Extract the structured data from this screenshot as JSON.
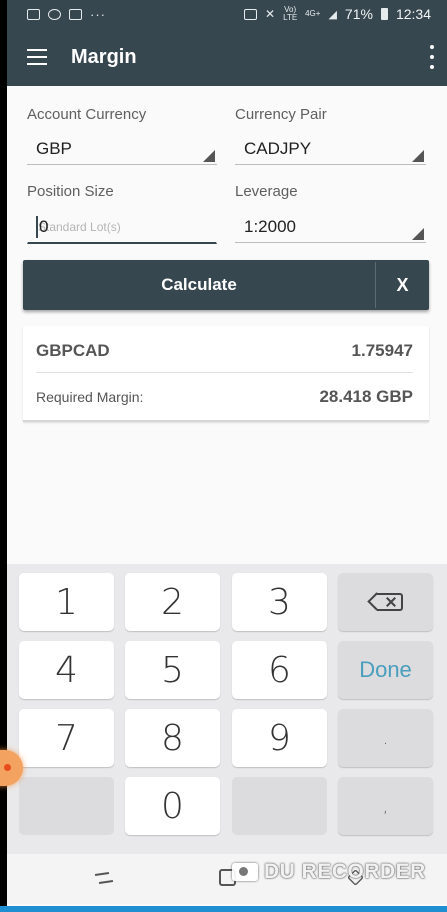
{
  "status_bar": {
    "battery": "71%",
    "time": "12:34",
    "signal_label_1": "Vo) LTE",
    "signal_label_2": "4G+"
  },
  "app_bar": {
    "title": "Margin"
  },
  "form": {
    "account_currency_label": "Account Currency",
    "account_currency_value": "GBP",
    "currency_pair_label": "Currency Pair",
    "currency_pair_value": "CADJPY",
    "position_size_label": "Position Size",
    "position_size_value": "0",
    "position_size_placeholder": "Standard Lot(s)",
    "leverage_label": "Leverage",
    "leverage_value": "1:2000"
  },
  "actions": {
    "calculate_label": "Calculate",
    "clear_label": "X"
  },
  "result": {
    "pair": "GBPCAD",
    "rate": "1.75947",
    "required_margin_label": "Required Margin:",
    "required_margin_value": "28.418 GBP"
  },
  "keyboard": {
    "keys": [
      "1",
      "2",
      "3",
      "4",
      "5",
      "6",
      "7",
      "8",
      "9",
      "0"
    ],
    "done_label": "Done",
    "period_label": ".",
    "comma_label": ","
  },
  "watermark": {
    "text": "DU RECORDER"
  },
  "colors": {
    "primary": "#37474f",
    "done_accent": "#4a9ebd",
    "recorder_bar": "#1f8fd1"
  }
}
